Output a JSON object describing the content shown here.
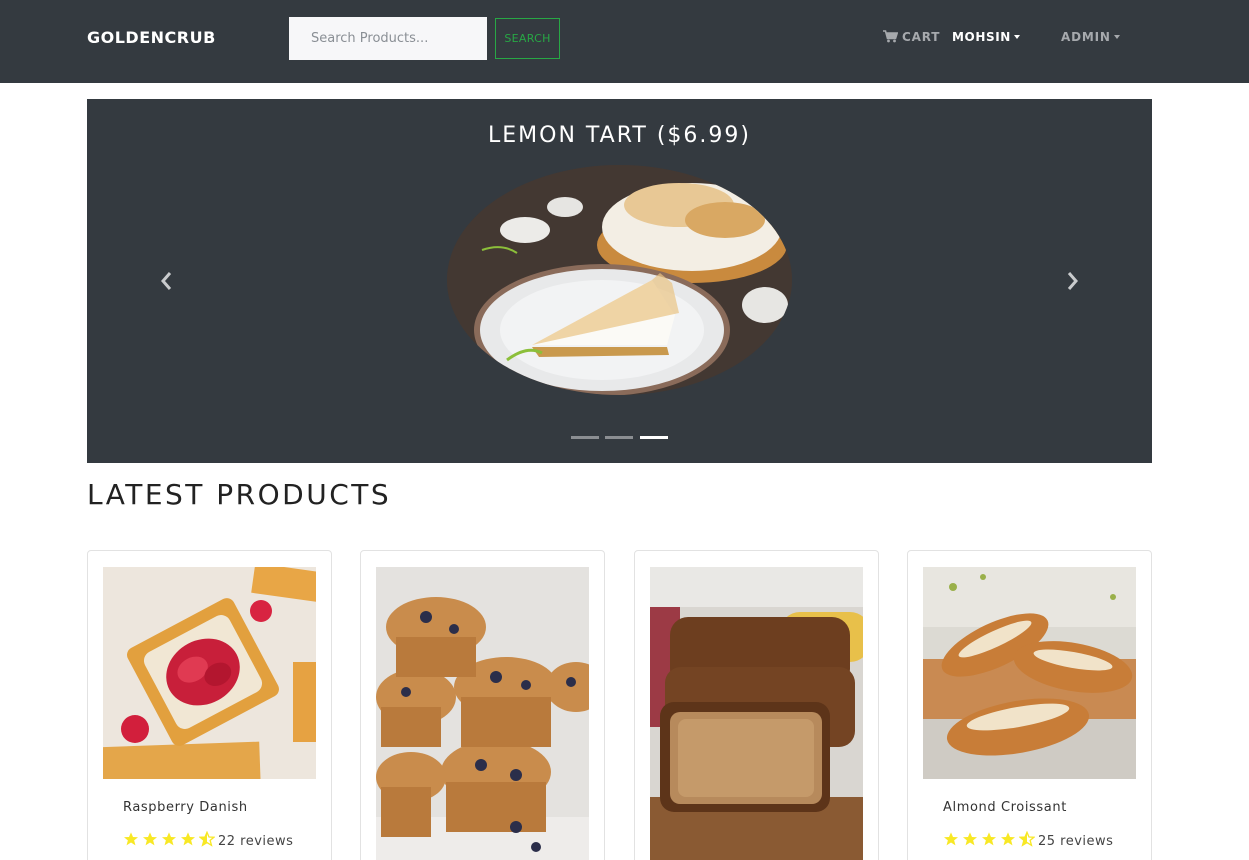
{
  "navbar": {
    "brand": "GOLDENCRUB",
    "search_placeholder": "Search Products...",
    "search_button": "SEARCH",
    "cart_label": "CART",
    "user_label": "MOHSIN",
    "admin_label": "ADMIN",
    "background": "#343a40",
    "accent": "#28a745"
  },
  "carousel": {
    "title": "LEMON TART ($6.99)",
    "slide_count": 3,
    "active_slide": 3
  },
  "section": {
    "title": "LATEST PRODUCTS"
  },
  "products": [
    {
      "name": "Raspberry Danish",
      "rating": 4.5,
      "reviews": "22 reviews"
    },
    {
      "name": "",
      "rating": null,
      "reviews": ""
    },
    {
      "name": "",
      "rating": null,
      "reviews": ""
    },
    {
      "name": "Almond Croissant",
      "rating": 4.5,
      "reviews": "25 reviews"
    }
  ],
  "star_color": "#f8e825"
}
